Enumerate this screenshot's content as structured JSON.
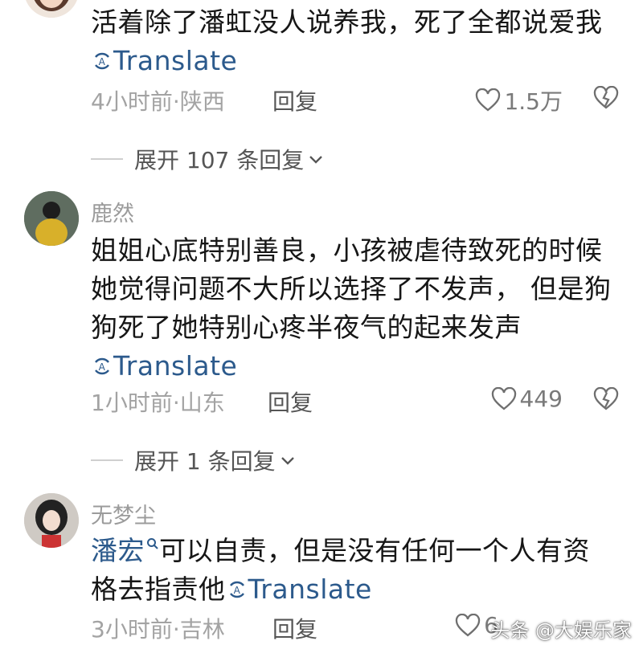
{
  "comments": [
    {
      "username": "",
      "text": "活着除了潘虹没人说养我，死了全都说爱我",
      "translate": "Translate",
      "time_location": "4小时前·陕西",
      "reply_label": "回复",
      "likes": "1.5万",
      "expand_label": "展开 107 条回复"
    },
    {
      "username": "鹿然",
      "text": "姐姐心底特别善良，小孩被虐待致死的时候她觉得问题不大所以选择了不发声， 但是狗狗死了她特别心疼半夜气的起来发声",
      "translate": "Translate",
      "time_location": "1小时前·山东",
      "reply_label": "回复",
      "likes": "449",
      "expand_label": "展开 1 条回复"
    },
    {
      "username": "无梦尘",
      "mention": "潘宏",
      "text": "可以自责，但是没有任何一个人有资格去指责他",
      "translate": "Translate",
      "time_location": "3小时前·吉林",
      "reply_label": "回复",
      "likes": "6"
    }
  ],
  "watermark": "头条 @大娱乐家",
  "icons": [
    "translate-icon",
    "heart-icon",
    "dislike-heart-icon",
    "chevron-down-icon",
    "search-icon"
  ],
  "colors": {
    "link": "#2c5a8c",
    "meta": "#a3a3a3",
    "text": "#161616"
  }
}
